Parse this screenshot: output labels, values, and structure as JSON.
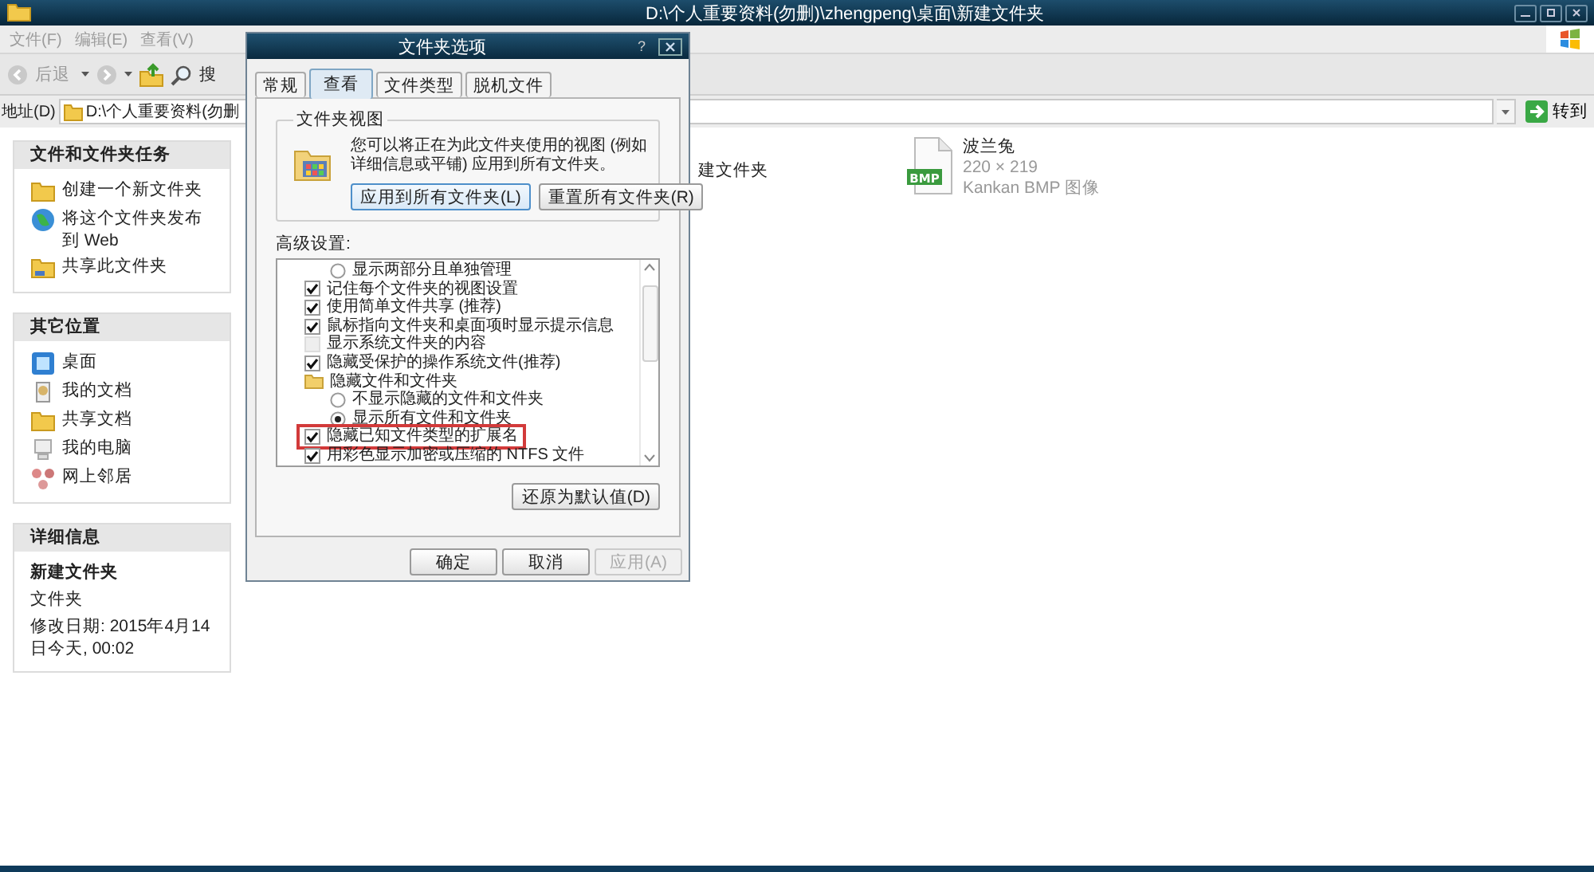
{
  "window": {
    "title": "D:\\个人重要资料(勿删)\\zhengpeng\\桌面\\新建文件夹"
  },
  "menu": [
    {
      "label": "文件(F)"
    },
    {
      "label": "编辑(E)"
    },
    {
      "label": "查看(V)"
    }
  ],
  "toolbar": {
    "back": "后退",
    "search": "搜"
  },
  "address": {
    "label": "地址(D)",
    "value": "D:\\个人重要资料(勿删",
    "go": "转到"
  },
  "task_panels": [
    {
      "title": "文件和文件夹任务",
      "items": [
        {
          "kind": "folder",
          "label": "创建一个新文件夹"
        },
        {
          "kind": "globe",
          "label": "将这个文件夹发布到 Web"
        },
        {
          "kind": "share",
          "label": "共享此文件夹"
        }
      ]
    },
    {
      "title": "其它位置",
      "items": [
        {
          "kind": "desktop",
          "label": "桌面"
        },
        {
          "kind": "documents",
          "label": "我的文档"
        },
        {
          "kind": "folder",
          "label": "共享文档"
        },
        {
          "kind": "computer",
          "label": "我的电脑"
        },
        {
          "kind": "network",
          "label": "网上邻居"
        }
      ]
    }
  ],
  "details": {
    "title": "详细信息",
    "name": "新建文件夹",
    "type": "文件夹",
    "modified": "修改日期: 2015年4月14日今天, 00:02"
  },
  "files": [
    {
      "kind": "folder",
      "name": "建文件夹"
    },
    {
      "kind": "bmp",
      "name": "波兰兔",
      "badge": "BMP",
      "dimensions": "220 × 219",
      "type": "Kankan BMP 图像"
    }
  ],
  "dialog": {
    "title": "文件夹选项",
    "help": "?",
    "tabs": [
      {
        "label": "常规",
        "selected": false
      },
      {
        "label": "查看",
        "selected": true
      },
      {
        "label": "文件类型",
        "selected": false
      },
      {
        "label": "脱机文件",
        "selected": false
      }
    ],
    "group": {
      "title": "文件夹视图",
      "description": "您可以将正在为此文件夹使用的视图 (例如详细信息或平铺) 应用到所有文件夹。",
      "buttons": [
        {
          "label": "应用到所有文件夹(L)",
          "focused": true
        },
        {
          "label": "重置所有文件夹(R)",
          "focused": false
        }
      ]
    },
    "advanced_label": "高级设置:",
    "settings": [
      {
        "kind": "radio",
        "label": "显示两部分且单独管理",
        "selected": false,
        "highlighted": false
      },
      {
        "kind": "checkbox",
        "label": "记住每个文件夹的视图设置",
        "checked": true,
        "highlighted": false
      },
      {
        "kind": "checkbox",
        "label": "使用简单文件共享 (推荐)",
        "checked": true,
        "highlighted": false
      },
      {
        "kind": "checkbox",
        "label": "鼠标指向文件夹和桌面项时显示提示信息",
        "checked": true,
        "highlighted": false
      },
      {
        "kind": "checkbox",
        "label": "显示系统文件夹的内容",
        "checked": false,
        "highlighted": false
      },
      {
        "kind": "checkbox",
        "label": "隐藏受保护的操作系统文件(推荐)",
        "checked": true,
        "highlighted": false
      },
      {
        "kind": "folder",
        "label": "隐藏文件和文件夹",
        "highlighted": false,
        "children": [
          {
            "kind": "radio",
            "label": "不显示隐藏的文件和文件夹",
            "selected": false,
            "highlighted": false
          },
          {
            "kind": "radio",
            "label": "显示所有文件和文件夹",
            "selected": true,
            "highlighted": false
          }
        ]
      },
      {
        "kind": "checkbox",
        "label": "隐藏已知文件类型的扩展名",
        "checked": true,
        "highlighted": true
      },
      {
        "kind": "checkbox",
        "label": "用彩色显示加密或压缩的 NTFS 文件",
        "checked": true,
        "highlighted": false
      }
    ],
    "restore": "还原为默认值(D)",
    "buttons": [
      {
        "label": "确定",
        "disabled": false
      },
      {
        "label": "取消",
        "disabled": false
      },
      {
        "label": "应用(A)",
        "disabled": true
      }
    ]
  }
}
